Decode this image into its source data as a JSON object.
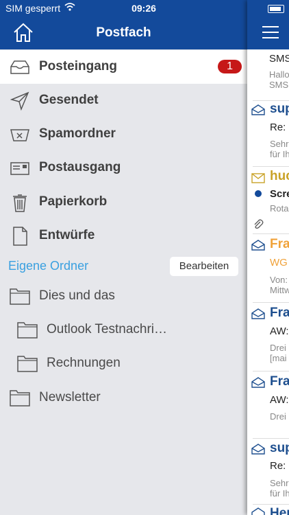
{
  "status": {
    "carrier": "SIM gesperrt",
    "time": "09:26"
  },
  "header": {
    "title": "Postfach"
  },
  "mailbox": {
    "items": [
      {
        "label": "Posteingang",
        "badge": "1"
      },
      {
        "label": "Gesendet"
      },
      {
        "label": "Spamordner"
      },
      {
        "label": "Postausgang"
      },
      {
        "label": "Papierkorb"
      },
      {
        "label": "Entwürfe"
      }
    ]
  },
  "own_folders": {
    "section_label": "Eigene Ordner",
    "edit_label": "Bearbeiten",
    "folders": [
      {
        "label": "Dies und das"
      },
      {
        "label": "Outlook Testnachri…"
      },
      {
        "label": "Rechnungen"
      },
      {
        "label": "Newsletter"
      }
    ]
  },
  "messages": [
    {
      "sender": "",
      "subject": "SMS",
      "preview": "Hallo\nSMS"
    },
    {
      "sender": "sup",
      "subject": "Re:",
      "preview": "Sehr\nfür Ih"
    },
    {
      "sender": "huc",
      "subject": "Scre",
      "preview": "Rota"
    },
    {
      "sender": "Fra",
      "subject": "WG",
      "preview": "Von:\nMittw"
    },
    {
      "sender": "Fra",
      "subject": "AW:",
      "preview": "Drei\n[mai"
    },
    {
      "sender": "Fra",
      "subject": "AW:",
      "preview": "Drei"
    },
    {
      "sender": "sup",
      "subject": "Re:",
      "preview": "Sehr\nfür Ih"
    },
    {
      "sender": "Her",
      "subject": "",
      "preview": ""
    }
  ],
  "colors": {
    "header": "#134a9b",
    "accent": "#3aa0e0",
    "badge": "#c61818",
    "sender_blue": "#1e4f8f",
    "sender_gold": "#c9a227",
    "sender_orange": "#f0a23a"
  }
}
